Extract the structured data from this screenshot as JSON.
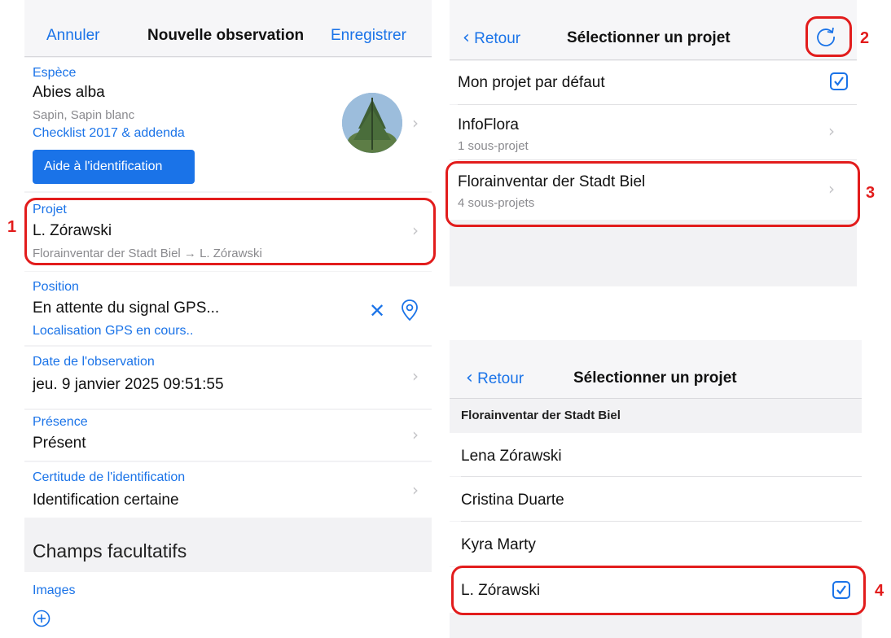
{
  "left": {
    "nav": {
      "cancel": "Annuler",
      "title": "Nouvelle observation",
      "save": "Enregistrer"
    },
    "species": {
      "label": "Espèce",
      "name": "Abies alba",
      "common": "Sapin, Sapin blanc",
      "checklist": "Checklist 2017 & addenda",
      "help_button": "Aide à l'identification"
    },
    "project": {
      "label": "Projet",
      "value": "L. Zórawski",
      "path": "Florainventar der Stadt Biel → L. Zórawski"
    },
    "position": {
      "label": "Position",
      "value": "En attente du signal GPS...",
      "status": "Localisation GPS en cours.."
    },
    "date": {
      "label": "Date de l'observation",
      "value": "jeu. 9 janvier 2025 09:51:55"
    },
    "presence": {
      "label": "Présence",
      "value": "Présent"
    },
    "certainty": {
      "label": "Certitude de l'identification",
      "value": "Identification certaine"
    },
    "optional": {
      "title": "Champs facultatifs"
    },
    "images": {
      "label": "Images"
    }
  },
  "select_project": {
    "back": "Retour",
    "title": "Sélectionner un projet",
    "items": [
      {
        "title": "Mon projet par défaut",
        "checked": true
      },
      {
        "title": "InfoFlora",
        "subtitle": "1 sous-projet"
      },
      {
        "title": "Florainventar der Stadt Biel",
        "subtitle": "4 sous-projets"
      }
    ]
  },
  "select_subproject": {
    "back": "Retour",
    "title": "Sélectionner un projet",
    "section": "Florainventar der Stadt Biel",
    "items": [
      {
        "title": "Lena Zórawski"
      },
      {
        "title": "Cristina Duarte"
      },
      {
        "title": "Kyra Marty"
      },
      {
        "title": "L. Zórawski",
        "checked": true
      }
    ]
  },
  "annotations": [
    "1",
    "2",
    "3",
    "4"
  ],
  "colors": {
    "accent": "#1a73e8",
    "annotation": "#e21c1c",
    "help_button_bg": "#1a73e8"
  }
}
